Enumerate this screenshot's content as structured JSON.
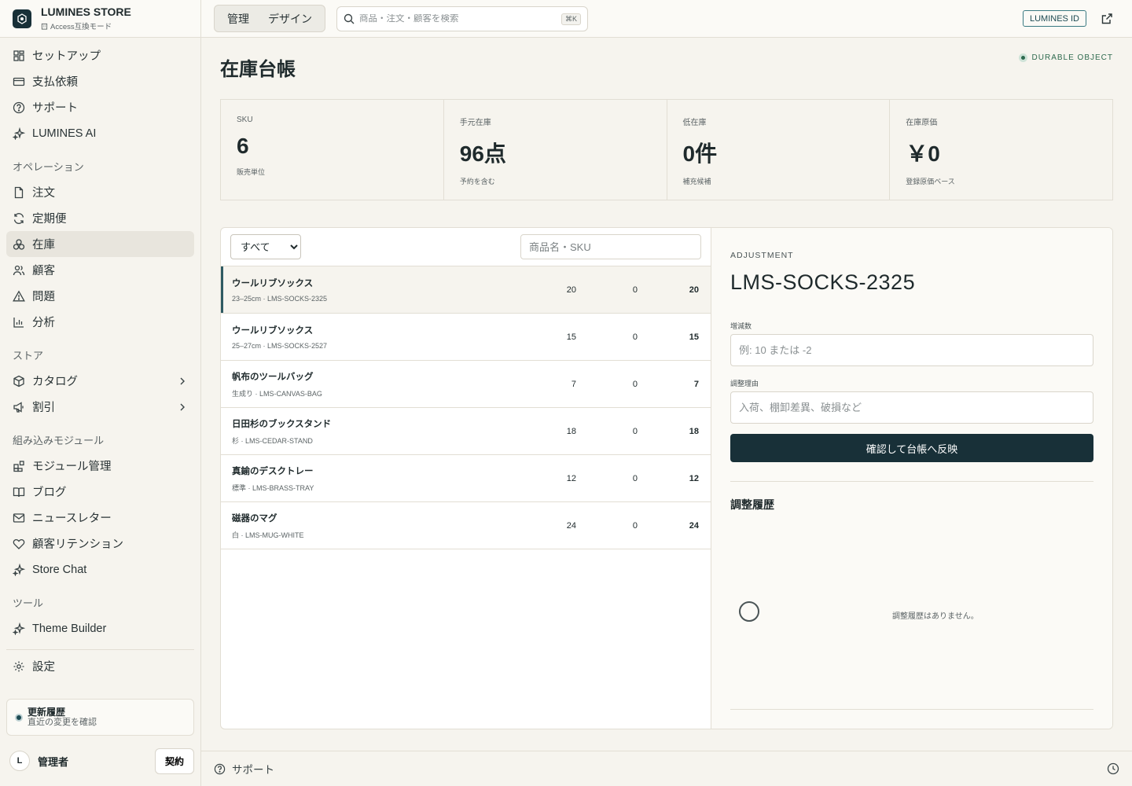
{
  "brand": {
    "name": "LUMINES STORE",
    "mode": "Access互換モード"
  },
  "sidebar": {
    "top": [
      {
        "label": "セットアップ",
        "icon": "grid-icon"
      },
      {
        "label": "支払依頼",
        "icon": "wallet-icon"
      },
      {
        "label": "サポート",
        "icon": "help-circle-icon"
      },
      {
        "label": "LUMINES AI",
        "icon": "sparkles-icon"
      }
    ],
    "sections": [
      {
        "title": "オペレーション",
        "items": [
          {
            "label": "注文",
            "icon": "file-icon"
          },
          {
            "label": "定期便",
            "icon": "refresh-icon"
          },
          {
            "label": "在庫",
            "icon": "boxes-icon",
            "active": true
          },
          {
            "label": "顧客",
            "icon": "users-icon"
          },
          {
            "label": "問題",
            "icon": "alert-triangle-icon"
          },
          {
            "label": "分析",
            "icon": "bar-chart-icon"
          }
        ]
      },
      {
        "title": "ストア",
        "items": [
          {
            "label": "カタログ",
            "icon": "package-icon",
            "chevron": true
          },
          {
            "label": "割引",
            "icon": "megaphone-icon",
            "chevron": true
          }
        ]
      },
      {
        "title": "組み込みモジュール",
        "items": [
          {
            "label": "モジュール管理",
            "icon": "blocks-icon"
          },
          {
            "label": "ブログ",
            "icon": "book-icon"
          },
          {
            "label": "ニュースレター",
            "icon": "mail-icon"
          },
          {
            "label": "顧客リテンション",
            "icon": "heart-icon"
          },
          {
            "label": "Store Chat",
            "icon": "sparkles-icon"
          }
        ]
      },
      {
        "title": "ツール",
        "items": [
          {
            "label": "Theme Builder",
            "icon": "sparkles-icon"
          }
        ]
      }
    ],
    "settings": "設定",
    "changelog": {
      "title": "更新履歴",
      "subtitle": "直近の変更を確認"
    },
    "user": {
      "initial": "L",
      "name": "管理者",
      "contract": "契約"
    }
  },
  "topbar": {
    "tabs": [
      "管理",
      "デザイン"
    ],
    "search_placeholder": "商品・注文・顧客を検索",
    "shortcut": "⌘K",
    "lumines_id": "LUMINES ID"
  },
  "page": {
    "title": "在庫台帳",
    "badge": "DURABLE OBJECT",
    "stats": [
      {
        "label": "SKU",
        "value": "6",
        "sub": "販売単位"
      },
      {
        "label": "手元在庫",
        "value": "96点",
        "sub": "予約を含む"
      },
      {
        "label": "低在庫",
        "value": "0件",
        "sub": "補充候補"
      },
      {
        "label": "在庫原価",
        "value": "￥0",
        "sub": "登録原価ベース"
      }
    ]
  },
  "inventory": {
    "filter": "すべて",
    "search_placeholder": "商品名・SKU",
    "rows": [
      {
        "name": "ウールリブソックス",
        "sku": "23–25cm · LMS-SOCKS-2325",
        "on_hand": "20",
        "reserved": "0",
        "available": "20"
      },
      {
        "name": "ウールリブソックス",
        "sku": "25–27cm · LMS-SOCKS-2527",
        "on_hand": "15",
        "reserved": "0",
        "available": "15"
      },
      {
        "name": "帆布のツールバッグ",
        "sku": "生成り · LMS-CANVAS-BAG",
        "on_hand": "7",
        "reserved": "0",
        "available": "7"
      },
      {
        "name": "日田杉のブックスタンド",
        "sku": "杉 · LMS-CEDAR-STAND",
        "on_hand": "18",
        "reserved": "0",
        "available": "18"
      },
      {
        "name": "真鍮のデスクトレー",
        "sku": "標準 · LMS-BRASS-TRAY",
        "on_hand": "12",
        "reserved": "0",
        "available": "12"
      },
      {
        "name": "磁器のマグ",
        "sku": "白 · LMS-MUG-WHITE",
        "on_hand": "24",
        "reserved": "0",
        "available": "24"
      }
    ]
  },
  "adjustment": {
    "label": "ADJUSTMENT",
    "sku": "LMS-SOCKS-2325",
    "qty_label": "増減数",
    "qty_placeholder": "例: 10 または -2",
    "reason_label": "調整理由",
    "reason_placeholder": "入荷、棚卸差異、破損など",
    "submit": "確認して台帳へ反映",
    "history_title": "調整履歴",
    "history_empty": "調整履歴はありません。"
  },
  "footer": {
    "support": "サポート"
  }
}
